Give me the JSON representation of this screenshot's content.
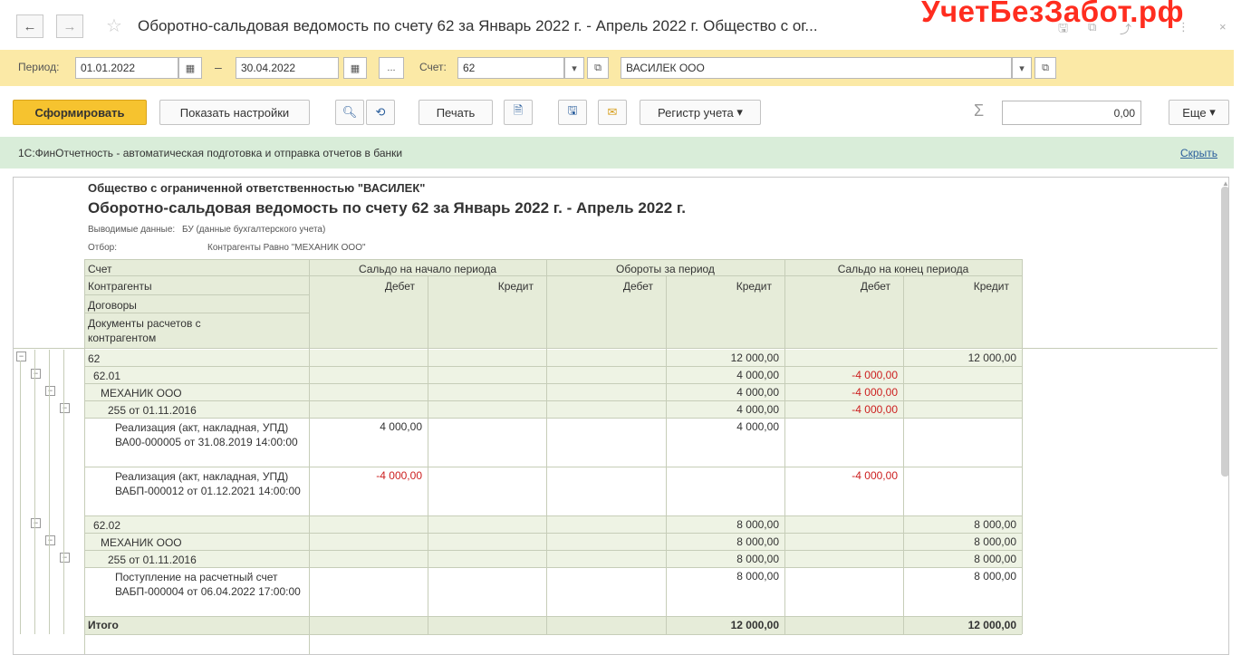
{
  "window": {
    "title": "Оборотно-сальдовая ведомость по счету 62 за Январь 2022 г. - Апрель 2022 г. Общество с ог...",
    "watermark": "УчетБезЗабот.рф",
    "back": "←",
    "forward": "→",
    "star": "☆",
    "icons": {
      "save": "🖫",
      "copy": "⧉",
      "link": "⤴",
      "more": "⋮",
      "close": "×"
    }
  },
  "params": {
    "period_label": "Период:",
    "date_from": "01.01.2022",
    "dash": "–",
    "date_to": "30.04.2022",
    "dots": "...",
    "account_label": "Счет:",
    "account": "62",
    "counterparty": "ВАСИЛЕК ООО"
  },
  "toolbar": {
    "form": "Сформировать",
    "settings": "Показать настройки",
    "print": "Печать",
    "register": "Регистр учета",
    "sum_value": "0,00",
    "more": "Еще",
    "sigma": "Σ"
  },
  "banner": {
    "link": "1С:ФинОтчетность",
    "text": " - автоматическая подготовка и отправка отчетов в банки",
    "hide": "Скрыть"
  },
  "report": {
    "org": "Общество с ограниченной ответственностью \"ВАСИЛЕК\"",
    "title": "Оборотно-сальдовая ведомость по счету 62 за Январь 2022 г. - Апрель 2022 г.",
    "output_label": "Выводимые данные:",
    "output_value": "БУ (данные бухгалтерского учета)",
    "filter_label": "Отбор:",
    "filter_value": "Контрагенты Равно \"МЕХАНИК ООО\"",
    "headers": {
      "account": "Счет",
      "counterparties": "Контрагенты",
      "contracts": "Договоры",
      "docs": "Документы расчетов с контрагентом",
      "opening": "Сальдо на начало периода",
      "turnover": "Обороты за период",
      "closing": "Сальдо на конец периода",
      "debit": "Дебет",
      "credit": "Кредит"
    },
    "rows": [
      {
        "name": "62",
        "od": "",
        "oc": "",
        "td": "",
        "tc": "12 000,00",
        "cd": "",
        "cc": "12 000,00"
      },
      {
        "name": "62.01",
        "od": "",
        "oc": "",
        "td": "",
        "tc": "4 000,00",
        "cd": "-4 000,00",
        "cc": ""
      },
      {
        "name": "МЕХАНИК ООО",
        "od": "",
        "oc": "",
        "td": "",
        "tc": "4 000,00",
        "cd": "-4 000,00",
        "cc": ""
      },
      {
        "name": "255 от 01.11.2016",
        "od": "",
        "oc": "",
        "td": "",
        "tc": "4 000,00",
        "cd": "-4 000,00",
        "cc": ""
      },
      {
        "name": "Реализация (акт, накладная, УПД) ВА00-000005 от 31.08.2019 14:00:00",
        "od": "4 000,00",
        "oc": "",
        "td": "",
        "tc": "4 000,00",
        "cd": "",
        "cc": ""
      },
      {
        "name": "Реализация (акт, накладная, УПД) ВАБП-000012 от 01.12.2021 14:00:00",
        "od": "-4 000,00",
        "oc": "",
        "td": "",
        "tc": "",
        "cd": "-4 000,00",
        "cc": ""
      },
      {
        "name": "62.02",
        "od": "",
        "oc": "",
        "td": "",
        "tc": "8 000,00",
        "cd": "",
        "cc": "8 000,00"
      },
      {
        "name": "МЕХАНИК ООО",
        "od": "",
        "oc": "",
        "td": "",
        "tc": "8 000,00",
        "cd": "",
        "cc": "8 000,00"
      },
      {
        "name": "255 от 01.11.2016",
        "od": "",
        "oc": "",
        "td": "",
        "tc": "8 000,00",
        "cd": "",
        "cc": "8 000,00"
      },
      {
        "name": "Поступление на расчетный счет ВАБП-000004 от 06.04.2022 17:00:00",
        "od": "",
        "oc": "",
        "td": "",
        "tc": "8 000,00",
        "cd": "",
        "cc": "8 000,00"
      }
    ],
    "total": {
      "name": "Итого",
      "tc": "12 000,00",
      "cc": "12 000,00"
    }
  }
}
